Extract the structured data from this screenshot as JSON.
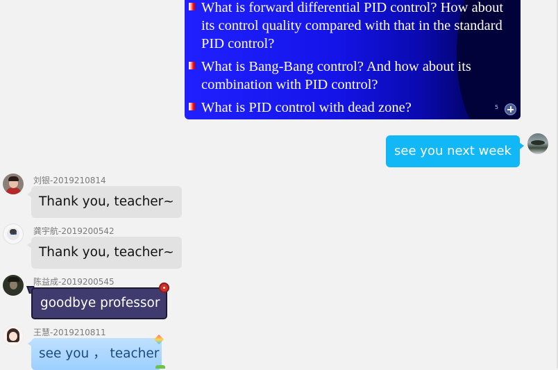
{
  "slide": {
    "bullets": [
      "What is forward differential PID control? How about its control quality compared with that in the standard PID control?",
      "What is Bang-Bang control? And how about its combination with PID control?",
      "What is PID control with dead zone?"
    ],
    "page_number": "5"
  },
  "outgoing": {
    "text": "see you next week"
  },
  "messages": [
    {
      "sender": "刘银-2019210814",
      "text": "Thank you, teacher~"
    },
    {
      "sender": "龚宇航-2019200542",
      "text": "Thank you, teacher~"
    },
    {
      "sender": "陈益成-2019200545",
      "text": "goodbye professor"
    },
    {
      "sender": "王慧-2019210811",
      "text": "see you ， teacher"
    }
  ],
  "colors": {
    "outgoing_bubble": "#12b7f5",
    "incoming_bubble": "#e2e2e2",
    "dark_bubble": "#3f3b6e",
    "blue_bubble": "#9ccfff",
    "background": "#f2f2f2"
  },
  "icons": [
    "zoom-in-icon",
    "bullet-icon"
  ]
}
